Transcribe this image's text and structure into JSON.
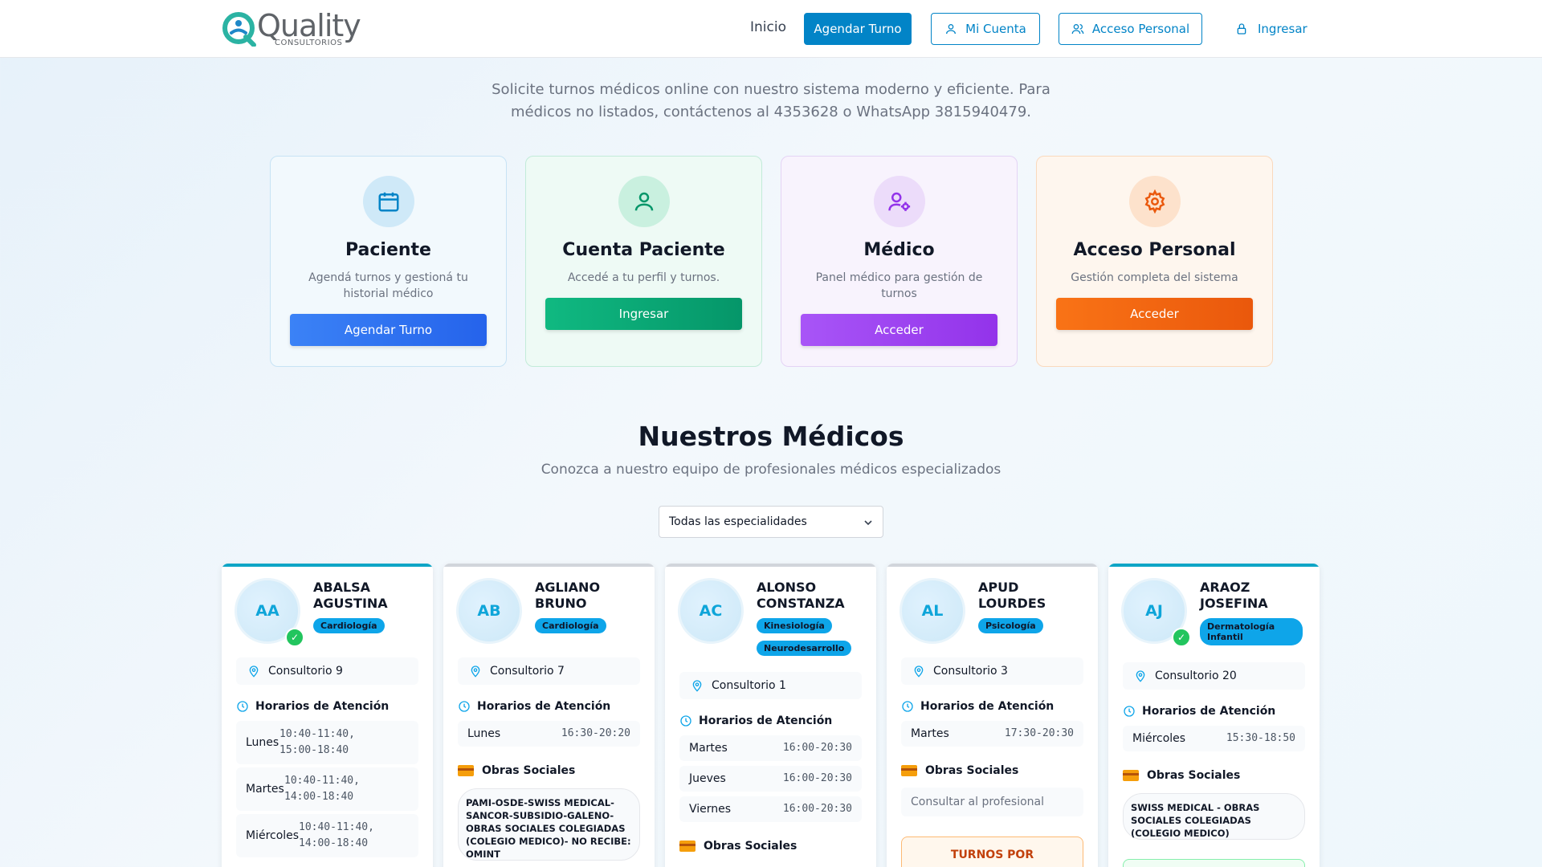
{
  "header": {
    "logo_word": "Quality",
    "logo_sub": "CONSULTORIOS",
    "nav_inicio": "Inicio",
    "btn_agendar": "Agendar Turno",
    "btn_mi_cuenta": "Mi Cuenta",
    "btn_acceso_personal": "Acceso Personal",
    "btn_ingresar": "Ingresar"
  },
  "intro": "Solicite turnos médicos online con nuestro sistema moderno y eficiente. Para médicos no listados, contáctenos al 4353628 o WhatsApp 3815940479.",
  "roles": [
    {
      "title": "Paciente",
      "desc": "Agendá turnos y gestioná tu historial médico",
      "button": "Agendar Turno",
      "icon": "calendar-icon"
    },
    {
      "title": "Cuenta Paciente",
      "desc": "Accedé a tu perfil y turnos.",
      "button": "Ingresar",
      "icon": "user-icon"
    },
    {
      "title": "Médico",
      "desc": "Panel médico para gestión de turnos",
      "button": "Acceder",
      "icon": "user-cog-icon"
    },
    {
      "title": "Acceso Personal",
      "desc": "Gestión completa del sistema",
      "button": "Acceder",
      "icon": "gear-icon"
    }
  ],
  "doctors_section": {
    "title": "Nuestros Médicos",
    "subtitle": "Conozca a nuestro equipo de profesionales médicos especializados",
    "filter_selected": "Todas las especialidades",
    "hours_title": "Horarios de Atención",
    "os_title": "Obras Sociales"
  },
  "doctors": [
    {
      "initials": "AA",
      "name": "ABALSA AGUSTINA",
      "verified": true,
      "specialties": [
        "Cardiología"
      ],
      "office": "Consultorio 9",
      "hours": [
        {
          "day": "Lunes",
          "time": "10:40-11:40, 15:00-18:40"
        },
        {
          "day": "Martes",
          "time": "10:40-11:40, 14:00-18:40"
        },
        {
          "day": "Miércoles",
          "time": "10:40-11:40, 14:00-18:40"
        }
      ]
    },
    {
      "initials": "AB",
      "name": "AGLIANO BRUNO",
      "verified": false,
      "specialties": [
        "Cardiología"
      ],
      "office": "Consultorio 7",
      "hours": [
        {
          "day": "Lunes",
          "time": "16:30-20:20"
        }
      ],
      "obras_sociales": "PAMI-OSDE-SWISS MEDICAL-SANCOR-SUBSIDIO-GALENO-OBRAS SOCIALES COLEGIADAS (COLEGIO MEDICO)- NO RECIBE: OMINT"
    },
    {
      "initials": "AC",
      "name": "ALONSO CONSTANZA",
      "verified": false,
      "specialties": [
        "Kinesiología",
        "Neurodesarrollo"
      ],
      "office": "Consultorio 1",
      "hours": [
        {
          "day": "Martes",
          "time": "16:00-20:30"
        },
        {
          "day": "Jueves",
          "time": "16:00-20:30"
        },
        {
          "day": "Viernes",
          "time": "16:00-20:30"
        }
      ]
    },
    {
      "initials": "AL",
      "name": "APUD LOURDES",
      "verified": false,
      "specialties": [
        "Psicología"
      ],
      "office": "Consultorio 3",
      "hours": [
        {
          "day": "Martes",
          "time": "17:30-20:30"
        }
      ],
      "obras_sociales": "Consultar al profesional",
      "phone_notice": "TURNOS POR"
    },
    {
      "initials": "AJ",
      "name": "ARAOZ JOSEFINA",
      "verified": true,
      "specialties": [
        "Dermatología Infantil"
      ],
      "office": "Consultorio 20",
      "hours": [
        {
          "day": "Miércoles",
          "time": "15:30-18:50"
        }
      ],
      "obras_sociales": "SWISS MEDICAL - OBRAS SOCIALES COLEGIADAS (COLEGIO MEDICO)"
    }
  ],
  "colors": {
    "primary": "#0284c7",
    "paciente": "#3b82f6",
    "cuenta": "#10b981",
    "medico": "#9333ea",
    "personal": "#f97316"
  }
}
